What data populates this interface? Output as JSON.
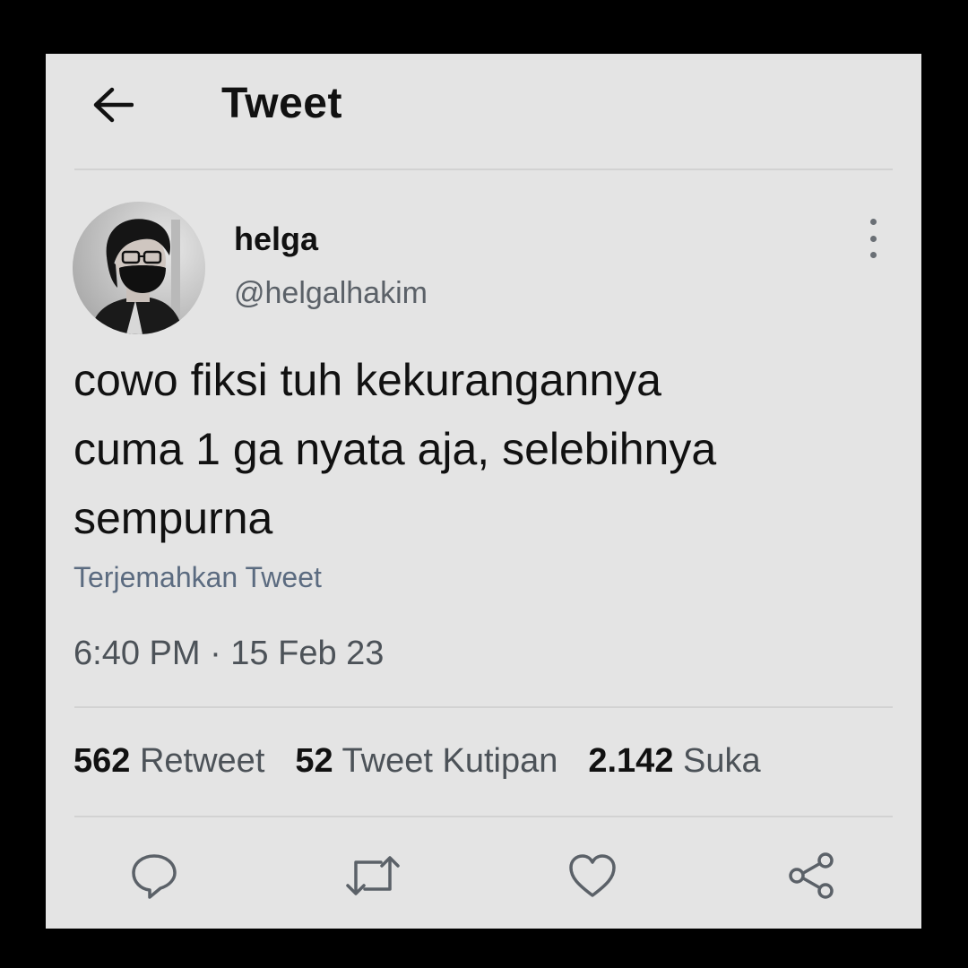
{
  "header": {
    "title": "Tweet",
    "back_icon": "arrow-left-icon"
  },
  "tweet": {
    "author_name": "helga",
    "author_handle": "@helgalhakim",
    "text": "cowo fiksi tuh kekurangannya\ncuma 1 ga nyata aja, selebihnya\nsempurna",
    "translate_label": "Terjemahkan Tweet",
    "timestamp": "6:40 PM · 15 Feb 23"
  },
  "stats": {
    "retweets_count": "562",
    "retweets_label": "Retweet",
    "quotes_count": "52",
    "quotes_label": "Tweet Kutipan",
    "likes_count": "2.142",
    "likes_label": "Suka"
  },
  "actions": {
    "icons": [
      "reply-icon",
      "retweet-icon",
      "like-icon",
      "share-icon"
    ]
  },
  "colors": {
    "background": "#000000",
    "card": "#e4e4e4",
    "text_primary": "#111111",
    "text_secondary": "#5b6168",
    "link": "#5b6b80"
  }
}
